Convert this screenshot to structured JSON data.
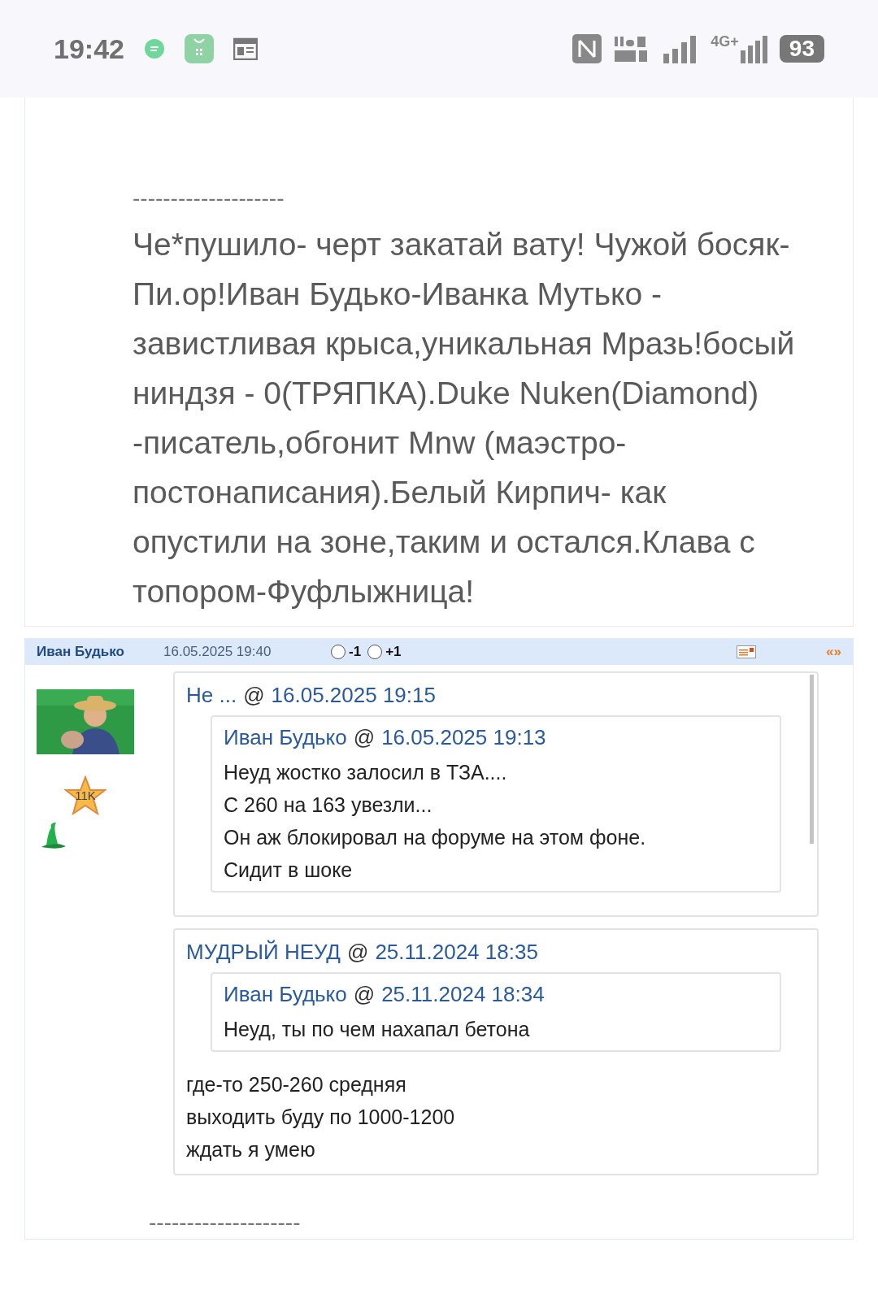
{
  "status_bar": {
    "time": "19:42",
    "network": "4G+",
    "battery": "93"
  },
  "previous_post": {
    "divider": "--------------------",
    "text": "Че*пушило- черт закатай вату! Чужой босяк- Пи.ор!Иван Будько-Иванка Мутько - завистливая крыса,уникальная Мразь!босый ниндзя - 0(ТРЯПКА).Duke Nuken(Diamond) -писатель,обгонит Mnw (маэстро-постонаписания).Белый Кирпич- как опустили на зоне,таким и остался.Клава с топором-Фуфлыжница!"
  },
  "post": {
    "author": "Иван Будько",
    "date": "16.05.2025 19:40",
    "votes": [
      {
        "label": "-1",
        "selected": false
      },
      {
        "label": "+1",
        "selected": false
      }
    ],
    "quote_link": "«»",
    "badge": "11K",
    "quotes": [
      {
        "author": "Не ...",
        "at": "@",
        "date": "16.05.2025 19:15",
        "scrollable": true,
        "inner": {
          "author": "Иван Будько",
          "at": "@",
          "date": "16.05.2025 19:13",
          "lines": [
            "Неуд жостко залосил в ТЗА....",
            "С 260 на 163 увезли...",
            "Он аж блокировал на форуме на этом фоне.",
            "Сидит в шоке"
          ]
        }
      },
      {
        "author": "МУДРЫЙ НЕУД",
        "at": "@",
        "date": "25.11.2024 18:35",
        "scrollable": false,
        "inner": {
          "author": "Иван Будько",
          "at": "@",
          "date": "25.11.2024 18:34",
          "lines": [
            "Неуд, ты по чем нахапал бетона"
          ]
        },
        "lines": [
          "где-то 250-260 средняя",
          "выходить буду по 1000-1200",
          "ждать я умею"
        ]
      }
    ],
    "divider": "--------------------"
  }
}
